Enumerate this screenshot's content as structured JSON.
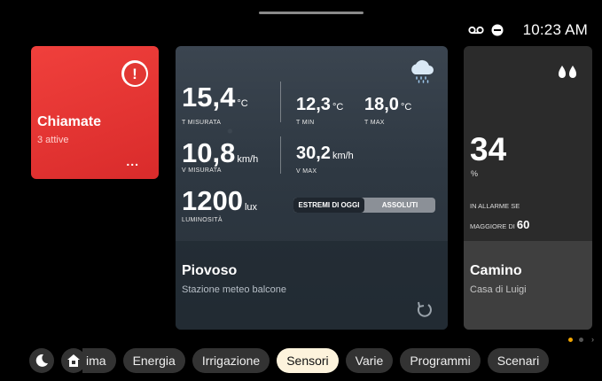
{
  "status": {
    "voicemail_icon": "voicemail-icon",
    "dnd_icon": "do-not-disturb-icon",
    "time": "10:23 AM"
  },
  "alarm_card": {
    "title": "Chiamate",
    "subtitle": "3 attive",
    "more": "...",
    "badge": "!",
    "color": "#e53935"
  },
  "meteo_card": {
    "temp": {
      "value": "15,4",
      "unit": "°C",
      "label": "T MISURATA"
    },
    "tmin": {
      "value": "12,3",
      "unit": "°C",
      "label": "T MIN"
    },
    "tmax": {
      "value": "18,0",
      "unit": "°C",
      "label": "T MAX"
    },
    "wind": {
      "value": "10,8",
      "unit": "km/h",
      "label": "V MISURATA"
    },
    "wmax": {
      "value": "30,2",
      "unit": "km/h",
      "label": "V MAX"
    },
    "lux": {
      "value": "1200",
      "unit": "lux",
      "label": "LUMINOSITÀ"
    },
    "segment": {
      "option1": "ESTREMI DI OGGI",
      "option2": "ASSOLUTI",
      "selected": "ESTREMI DI OGGI"
    },
    "title": "Piovoso",
    "subtitle": "Stazione meteo balcone"
  },
  "humidity_card": {
    "value": "34",
    "unit": "%",
    "alarm_label": "IN ALLARME SE",
    "alarm_condition": "MAGGIORE DI",
    "alarm_threshold": "60",
    "title": "Camino",
    "subtitle": "Casa di Luigi"
  },
  "pager": {
    "pages": 2,
    "current": 1,
    "next": "›"
  },
  "nav": {
    "tabs": [
      "ima",
      "Energia",
      "Irrigazione",
      "Sensori",
      "Varie",
      "Programmi",
      "Scenari"
    ],
    "active": "Sensori"
  }
}
